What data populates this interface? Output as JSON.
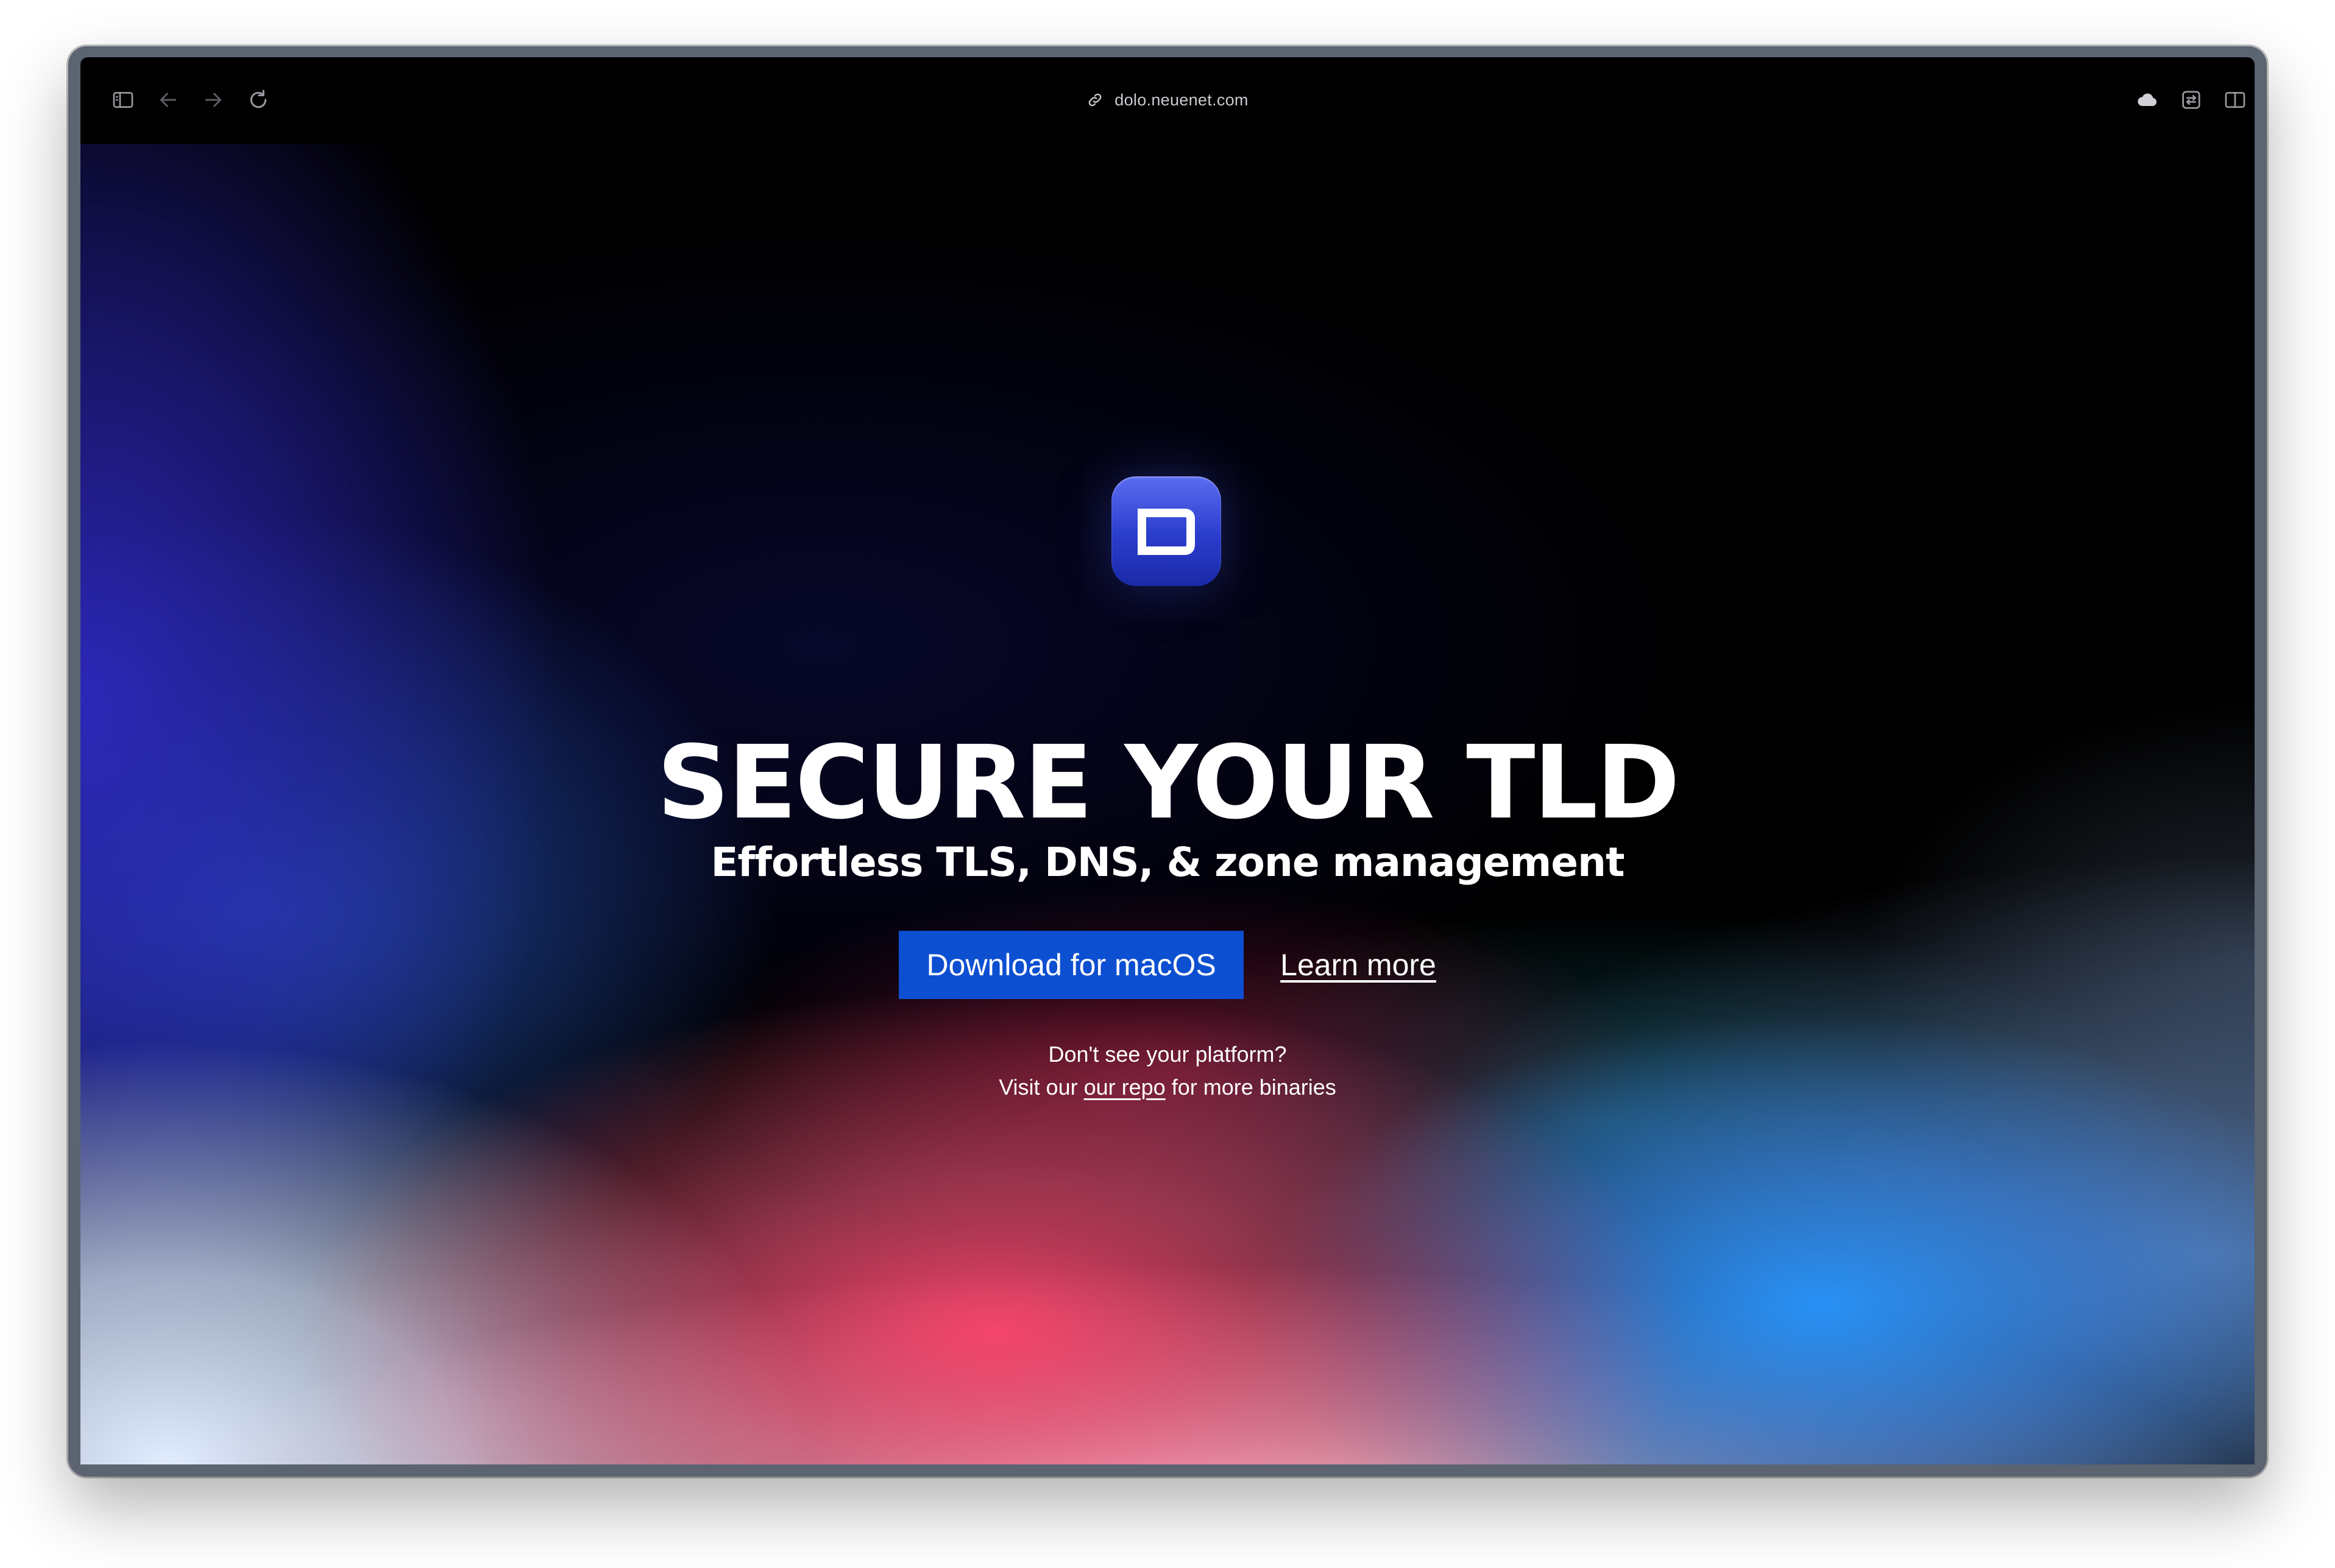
{
  "browser": {
    "url": "dolo.neuenet.com",
    "icons": {
      "sidebar": "sidebar-icon",
      "back": "arrow-left-icon",
      "forward": "arrow-right-icon",
      "reload": "reload-icon",
      "link": "link-icon",
      "cloud": "cloud-icon",
      "extension": "extension-icon",
      "split_view": "split-view-icon"
    }
  },
  "hero": {
    "logo_icon": "app-logo-icon",
    "headline": "SECURE YOUR TLD",
    "subheadline": "Effortless TLS, DNS, & zone management",
    "download_button": "Download for macOS",
    "learn_more": "Learn more",
    "platform_line1": "Don't see your platform?",
    "platform_line2_prefix": "Visit our ",
    "platform_link": "our repo",
    "platform_line2_suffix": " for more binaries"
  },
  "colors": {
    "button_blue": "#0d4fd1",
    "logo_blue": "#2a3ccc",
    "background": "#000000"
  }
}
